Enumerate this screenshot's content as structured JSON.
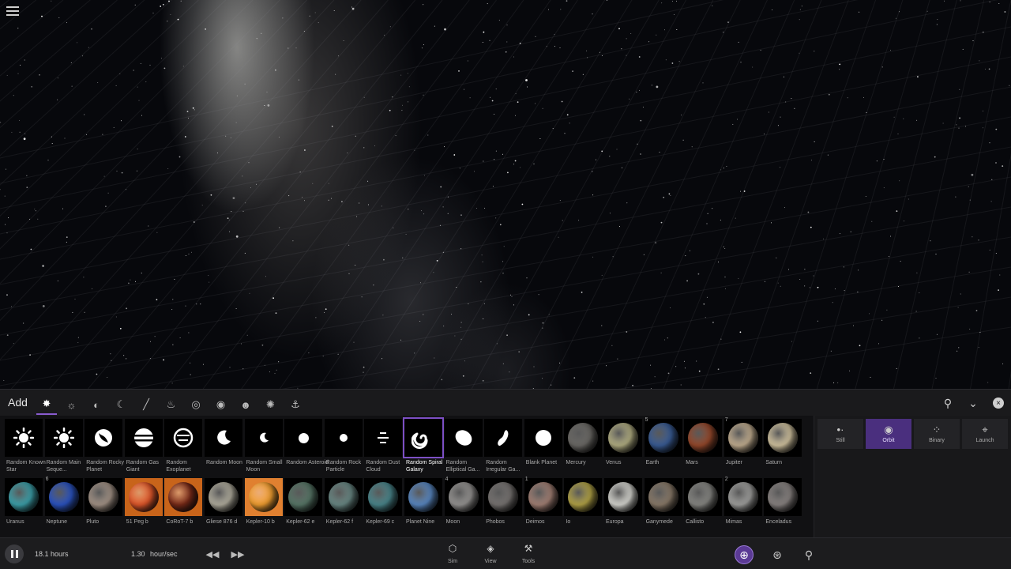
{
  "topbar": {
    "menu_icon": "hamburger-icon"
  },
  "addbar": {
    "title": "Add",
    "categories": [
      {
        "name": "star-system",
        "glyph": "✸"
      },
      {
        "name": "star",
        "glyph": "☼"
      },
      {
        "name": "planet",
        "glyph": "◐"
      },
      {
        "name": "moon",
        "glyph": "☾"
      },
      {
        "name": "comet",
        "glyph": "╱"
      },
      {
        "name": "spacecraft",
        "glyph": "♨"
      },
      {
        "name": "galaxy",
        "glyph": "◎"
      },
      {
        "name": "eye",
        "glyph": "◉"
      },
      {
        "name": "people",
        "glyph": "☻"
      },
      {
        "name": "particle",
        "glyph": "✺"
      },
      {
        "name": "anchor",
        "glyph": "⚓"
      }
    ]
  },
  "objects_row1": [
    {
      "label": "Random Known Star",
      "kind": "sun",
      "num": ""
    },
    {
      "label": "Random Main Seque...",
      "kind": "sun",
      "num": ""
    },
    {
      "label": "Random Rocky Planet",
      "kind": "rocky",
      "num": ""
    },
    {
      "label": "Random Gas Giant",
      "kind": "gas",
      "num": ""
    },
    {
      "label": "Random Exoplanet",
      "kind": "exo",
      "num": ""
    },
    {
      "label": "Random Moon",
      "kind": "moon",
      "num": ""
    },
    {
      "label": "Random Small Moon",
      "kind": "smallmoon",
      "num": ""
    },
    {
      "label": "Random Asteroid",
      "kind": "dot",
      "num": ""
    },
    {
      "label": "Random Rock Particle",
      "kind": "smalldot",
      "num": ""
    },
    {
      "label": "Random Dust Cloud",
      "kind": "dust",
      "num": ""
    },
    {
      "label": "Random Spiral Galaxy",
      "kind": "spiral",
      "num": ""
    },
    {
      "label": "Random Elliptical Ga...",
      "kind": "ellipse",
      "num": ""
    },
    {
      "label": "Random Irregular Ga...",
      "kind": "irregular",
      "num": ""
    },
    {
      "label": "Blank Planet",
      "kind": "blank",
      "num": ""
    },
    {
      "label": "Mercury",
      "kind": "planet",
      "color": "#6e6c68",
      "num": ""
    },
    {
      "label": "Venus",
      "kind": "planet",
      "color": "#b8b486",
      "num": ""
    },
    {
      "label": "Earth",
      "kind": "planet",
      "color": "#3b5f9a",
      "num": "5"
    },
    {
      "label": "Mars",
      "kind": "planet",
      "color": "#9a4a2c",
      "num": ""
    },
    {
      "label": "Jupiter",
      "kind": "planet",
      "color": "#c8b394",
      "num": "7"
    },
    {
      "label": "Saturn",
      "kind": "planet",
      "color": "#d8c9a4",
      "num": ""
    }
  ],
  "objects_row2": [
    {
      "label": "Uranus",
      "kind": "planet",
      "color": "#3ea6b0",
      "num": ""
    },
    {
      "label": "Neptune",
      "kind": "planet",
      "color": "#2c56c8",
      "num": "6"
    },
    {
      "label": "Pluto",
      "kind": "planet",
      "color": "#a8978a",
      "num": ""
    },
    {
      "label": "51 Peg b",
      "kind": "planet",
      "color": "#e2572a",
      "num": "",
      "bg": "orange"
    },
    {
      "label": "CoRoT-7 b",
      "kind": "planet",
      "color": "#7a2a18",
      "num": "",
      "bg": "orange"
    },
    {
      "label": "Gliese 876 d",
      "kind": "planet",
      "color": "#b6b2a2",
      "num": ""
    },
    {
      "label": "Kepler-10 b",
      "kind": "planet",
      "color": "#f4a030",
      "num": "",
      "bg": "orange2"
    },
    {
      "label": "Kepler-62 e",
      "kind": "planet",
      "color": "#5a7a6a",
      "num": ""
    },
    {
      "label": "Kepler-62 f",
      "kind": "planet",
      "color": "#6c8c88",
      "num": ""
    },
    {
      "label": "Kepler-69 c",
      "kind": "planet",
      "color": "#4c8a90",
      "num": ""
    },
    {
      "label": "Planet Nine",
      "kind": "planet",
      "color": "#5c8cc8",
      "num": ""
    },
    {
      "label": "Moon",
      "kind": "planet",
      "color": "#9a9896",
      "num": "4"
    },
    {
      "label": "Phobos",
      "kind": "planet",
      "color": "#7a7674",
      "num": ""
    },
    {
      "label": "Deimos",
      "kind": "planet",
      "color": "#a88478",
      "num": "1"
    },
    {
      "label": "Io",
      "kind": "planet",
      "color": "#b8a848",
      "num": ""
    },
    {
      "label": "Europa",
      "kind": "planet",
      "color": "#dcdcd6",
      "num": ""
    },
    {
      "label": "Ganymede",
      "kind": "planet",
      "color": "#8e7e6c",
      "num": ""
    },
    {
      "label": "Callisto",
      "kind": "planet",
      "color": "#8a8a86",
      "num": ""
    },
    {
      "label": "Mimas",
      "kind": "planet",
      "color": "#a4a4a2",
      "num": "2"
    },
    {
      "label": "Enceladus",
      "kind": "planet",
      "color": "#8c8684",
      "num": ""
    }
  ],
  "modes": [
    {
      "label": "Still",
      "glyph": "•·"
    },
    {
      "label": "Orbit",
      "glyph": "◉"
    },
    {
      "label": "Binary",
      "glyph": "⁘"
    },
    {
      "label": "Launch",
      "glyph": "⌖"
    }
  ],
  "bottom": {
    "time": "18.1 hours",
    "rate_value": "1.30",
    "rate_unit": "hour/sec",
    "rewind": "◀◀",
    "forward": "▶▶",
    "tools": [
      {
        "label": "Sim",
        "glyph": "⬡"
      },
      {
        "label": "View",
        "glyph": "◈"
      },
      {
        "label": "Tools",
        "glyph": "⚒"
      }
    ]
  },
  "colors": {
    "accent": "#7c4fc4",
    "active_mode": "#4a2f7e"
  }
}
